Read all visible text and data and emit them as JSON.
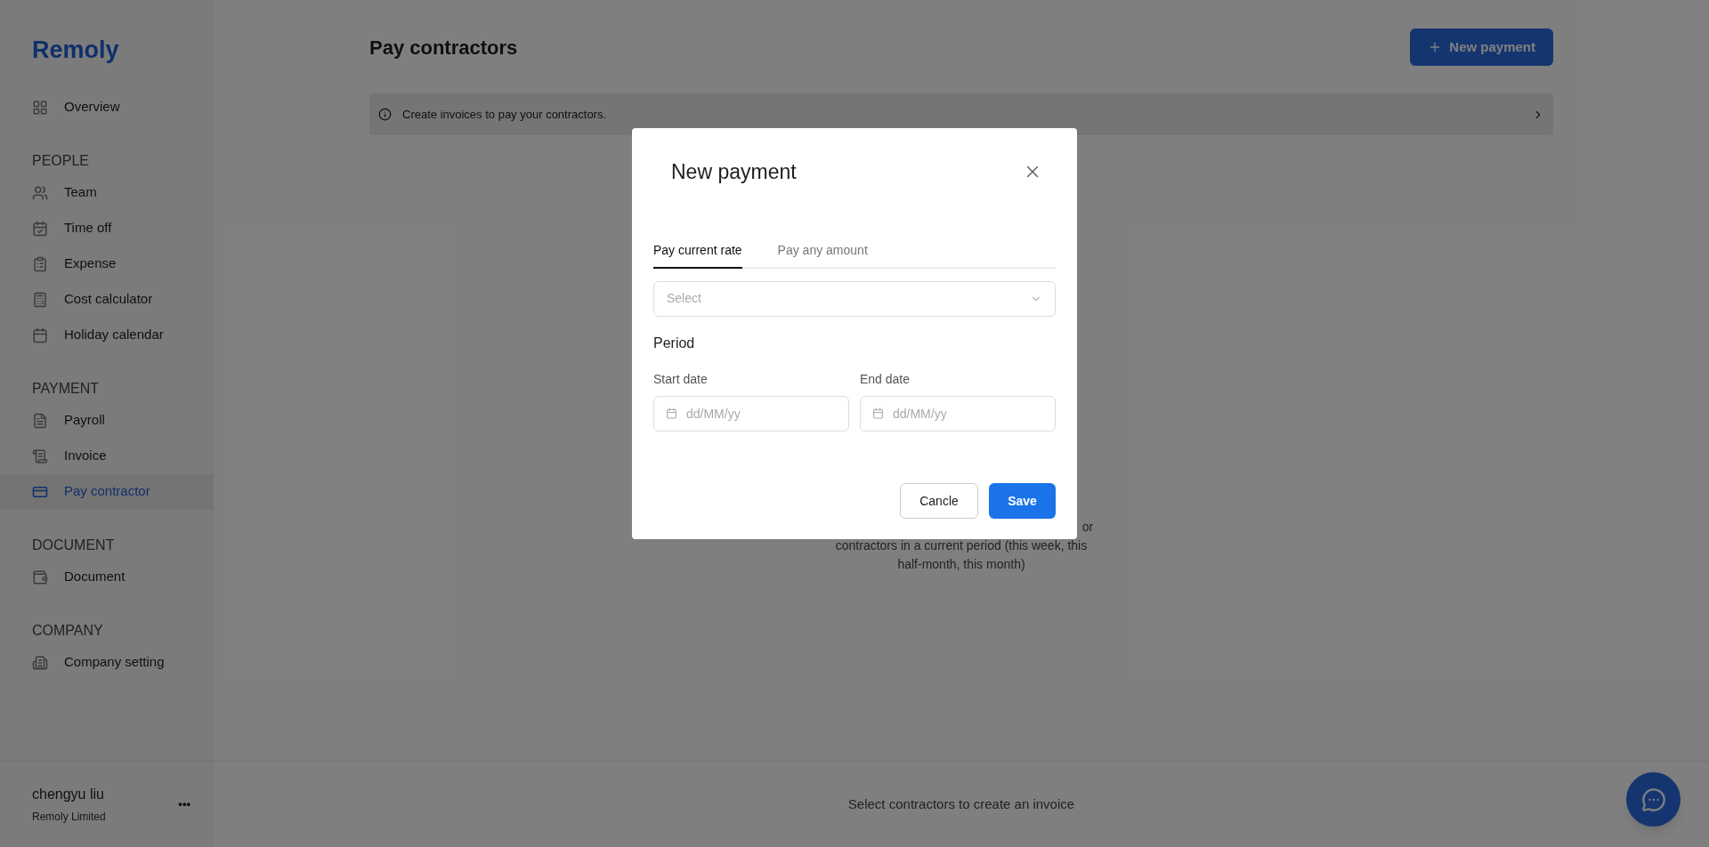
{
  "sidebar": {
    "logo": "Remoly",
    "sections": [
      {
        "items": [
          {
            "label": "Overview",
            "selected": false
          }
        ]
      },
      {
        "heading": "PEOPLE",
        "items": [
          {
            "label": "Team",
            "selected": false
          },
          {
            "label": "Time off",
            "selected": false
          },
          {
            "label": "Expense",
            "selected": false
          },
          {
            "label": "Cost calculator",
            "selected": false
          },
          {
            "label": "Holiday calendar",
            "selected": false
          }
        ]
      },
      {
        "heading": "PAYMENT",
        "items": [
          {
            "label": "Payroll",
            "selected": false
          },
          {
            "label": "Invoice",
            "selected": false
          },
          {
            "label": "Pay contractor",
            "selected": true
          }
        ]
      },
      {
        "heading": "DOCUMENT",
        "items": [
          {
            "label": "Document",
            "selected": false
          }
        ]
      },
      {
        "heading": "COMPANY",
        "items": [
          {
            "label": "Company setting",
            "selected": false
          }
        ]
      }
    ],
    "user": {
      "name": "chengyu liu",
      "company": "Remoly Limited",
      "menu": "•••"
    }
  },
  "page": {
    "title": "Pay contractors",
    "new_button": "New payment",
    "info": "Create invoices to pay your contractors.",
    "empty_state": {
      "line_end": "or",
      "lines": [
        "contractors in a current period (this week, this",
        "half-month, this month)"
      ]
    },
    "footer": "Select contractors to create an invoice"
  },
  "modal": {
    "title": "New payment",
    "tabs": [
      {
        "label": "Pay current rate",
        "selected": true
      },
      {
        "label": "Pay any amount",
        "selected": false
      }
    ],
    "select": {
      "placeholder": "Select"
    },
    "period": "Period",
    "dates": [
      {
        "label": "Start date",
        "placeholder": "dd/MM/yy"
      },
      {
        "label": "End date",
        "placeholder": "dd/MM/yy"
      }
    ],
    "buttons": {
      "cancel": "Cancle",
      "save": "Save"
    }
  }
}
